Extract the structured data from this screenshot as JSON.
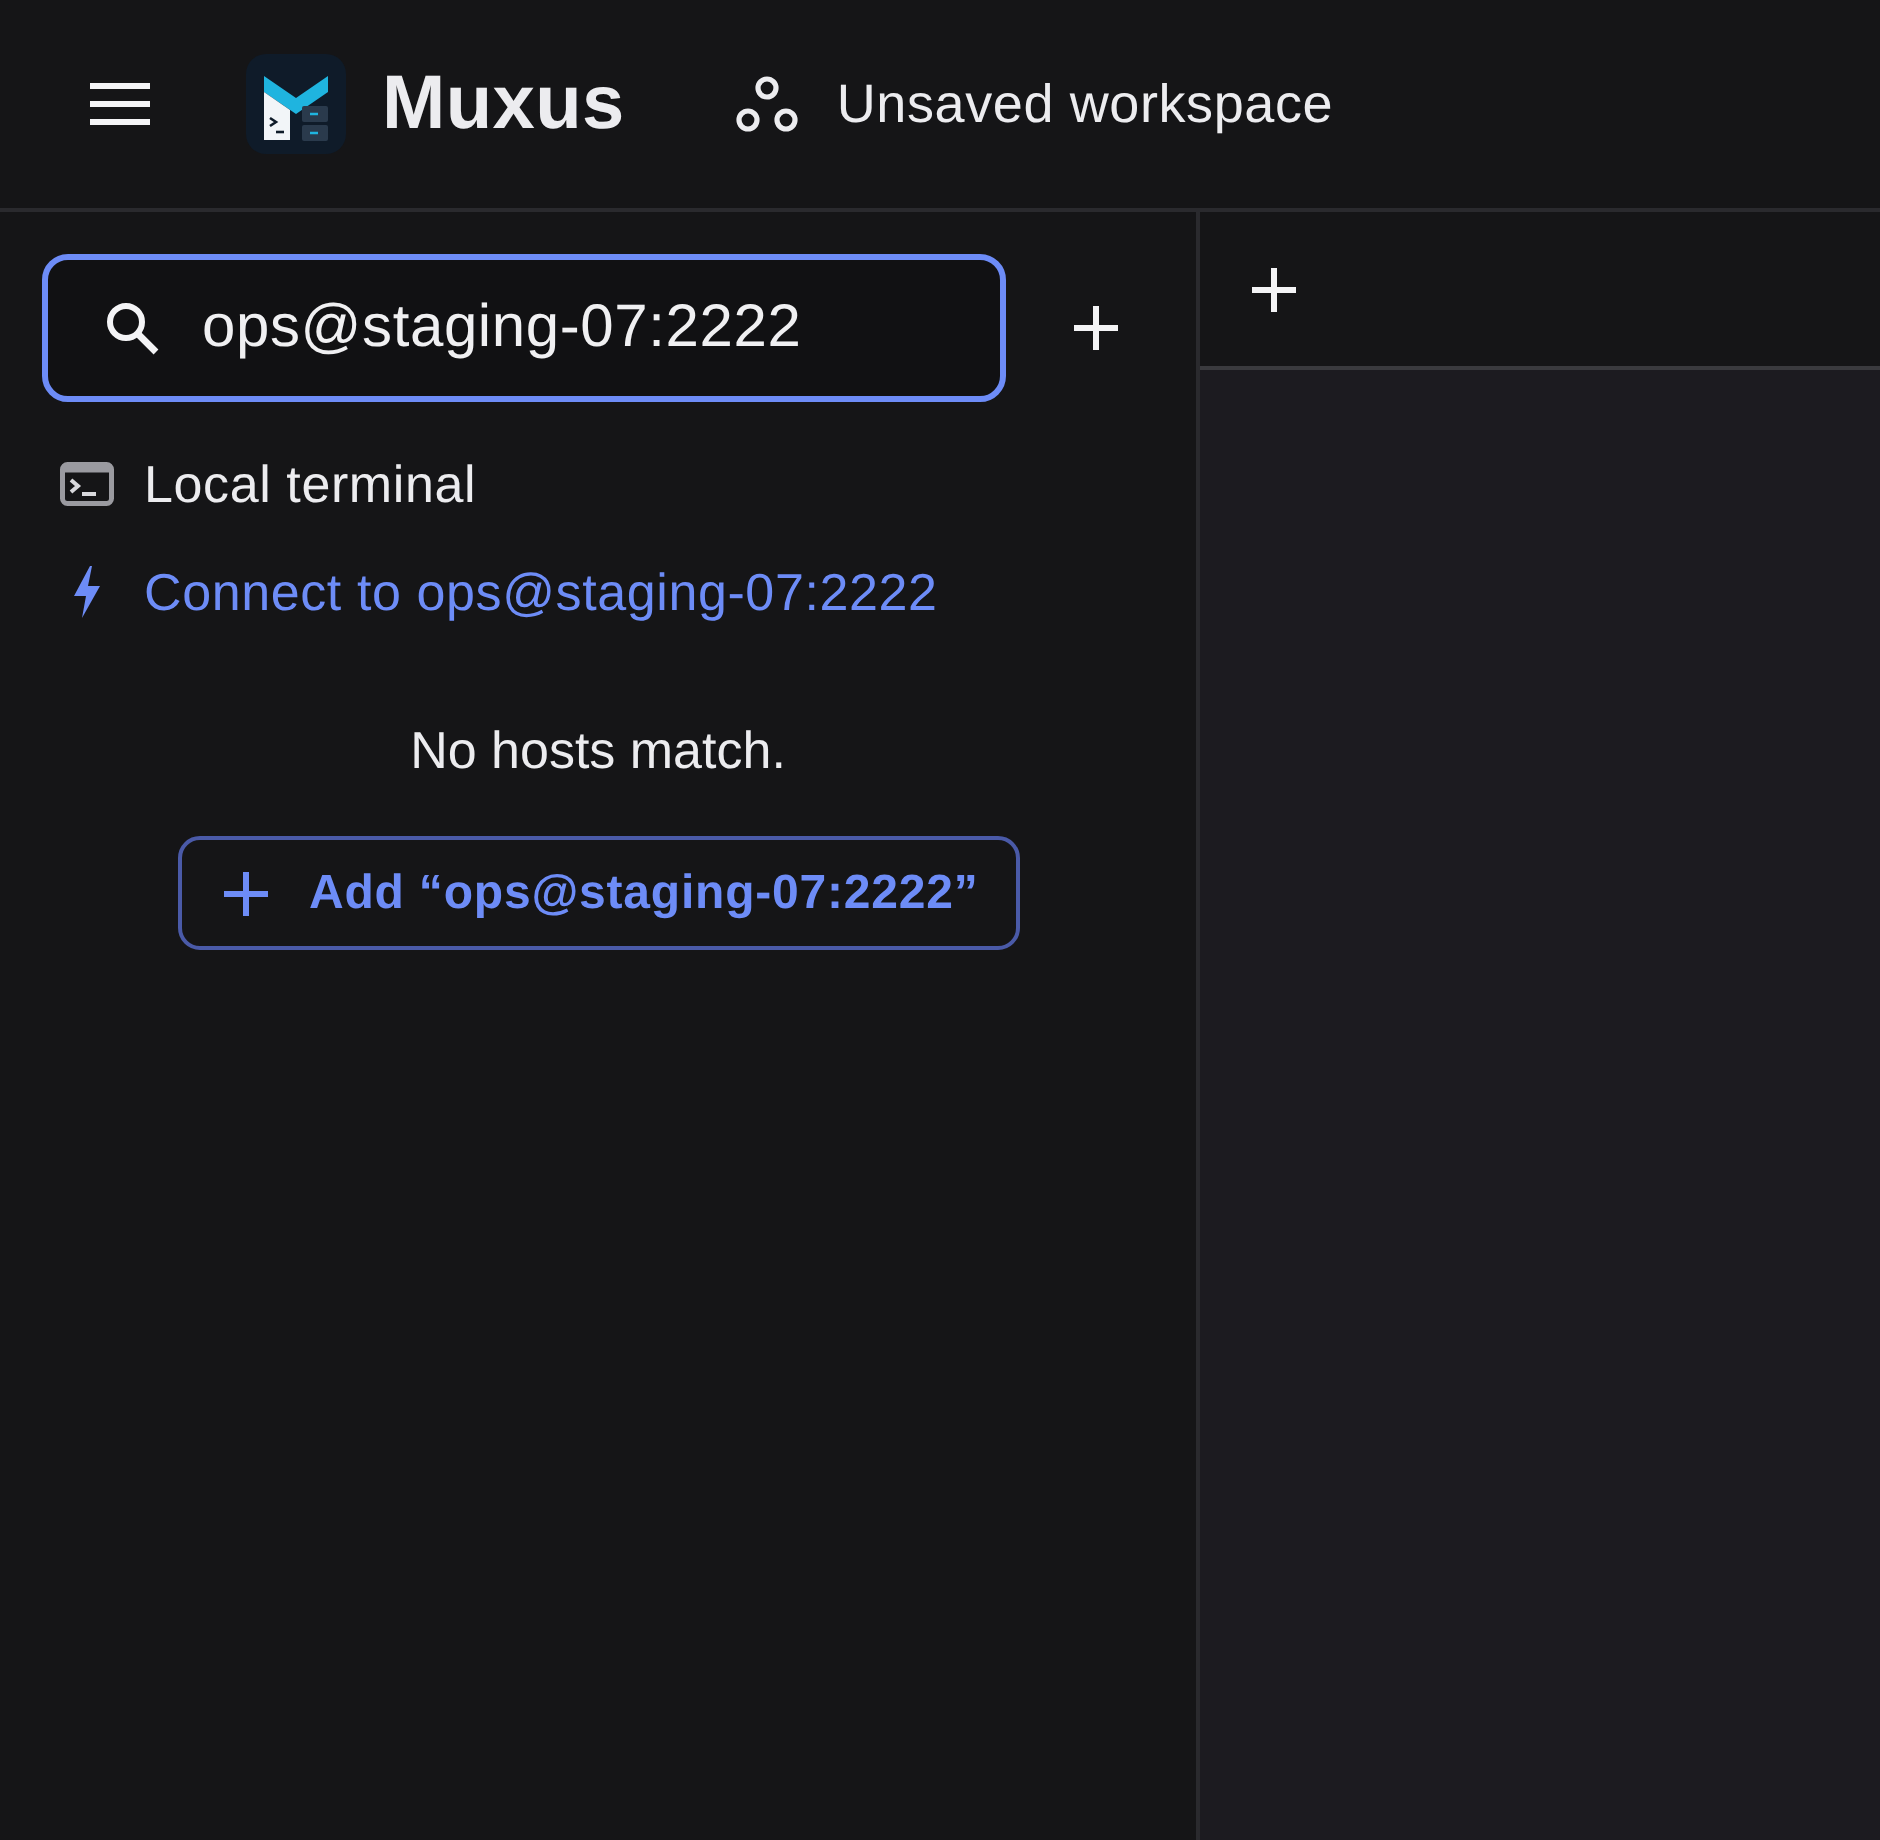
{
  "header": {
    "app_name": "Muxus",
    "workspace": "Unsaved workspace"
  },
  "sidebar": {
    "search": {
      "value": "ops@staging-07:2222",
      "focused": true
    },
    "items": [
      {
        "kind": "local",
        "label": "Local terminal"
      },
      {
        "kind": "connect",
        "label": "Connect to ops@staging-07:2222"
      }
    ],
    "empty_message": "No hosts match.",
    "add_button": {
      "label": "Add “ops@staging-07:2222”"
    }
  }
}
